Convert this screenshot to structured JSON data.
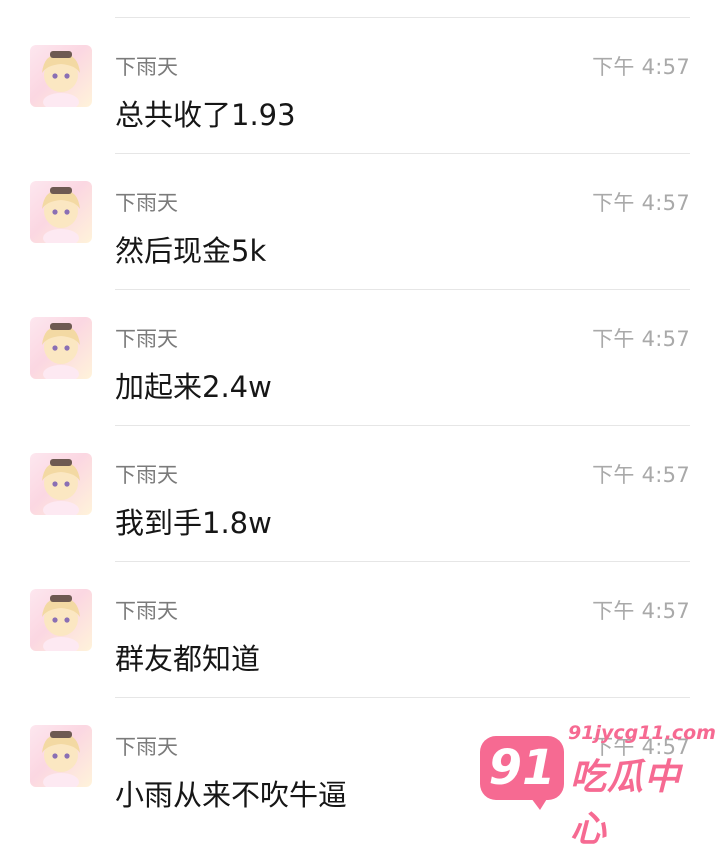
{
  "messages": [
    {
      "sender": "下雨天",
      "time": "下午 4:57",
      "text": "总共收了1.93"
    },
    {
      "sender": "下雨天",
      "time": "下午 4:57",
      "text": "然后现金5k"
    },
    {
      "sender": "下雨天",
      "time": "下午 4:57",
      "text": "加起来2.4w"
    },
    {
      "sender": "下雨天",
      "time": "下午 4:57",
      "text": "我到手1.8w"
    },
    {
      "sender": "下雨天",
      "time": "下午 4:57",
      "text": "群友都知道"
    },
    {
      "sender": "下雨天",
      "time": "下午 4:57",
      "text": "小雨从来不吹牛逼"
    }
  ],
  "watermark": {
    "number": "91",
    "site": "91jycg11.com",
    "name": "吃瓜中心"
  },
  "colors": {
    "accent": "#f66a92",
    "sender": "#7b7b7b",
    "time": "#a9a9a9",
    "text": "#161616",
    "divider": "#e6e6e6"
  }
}
